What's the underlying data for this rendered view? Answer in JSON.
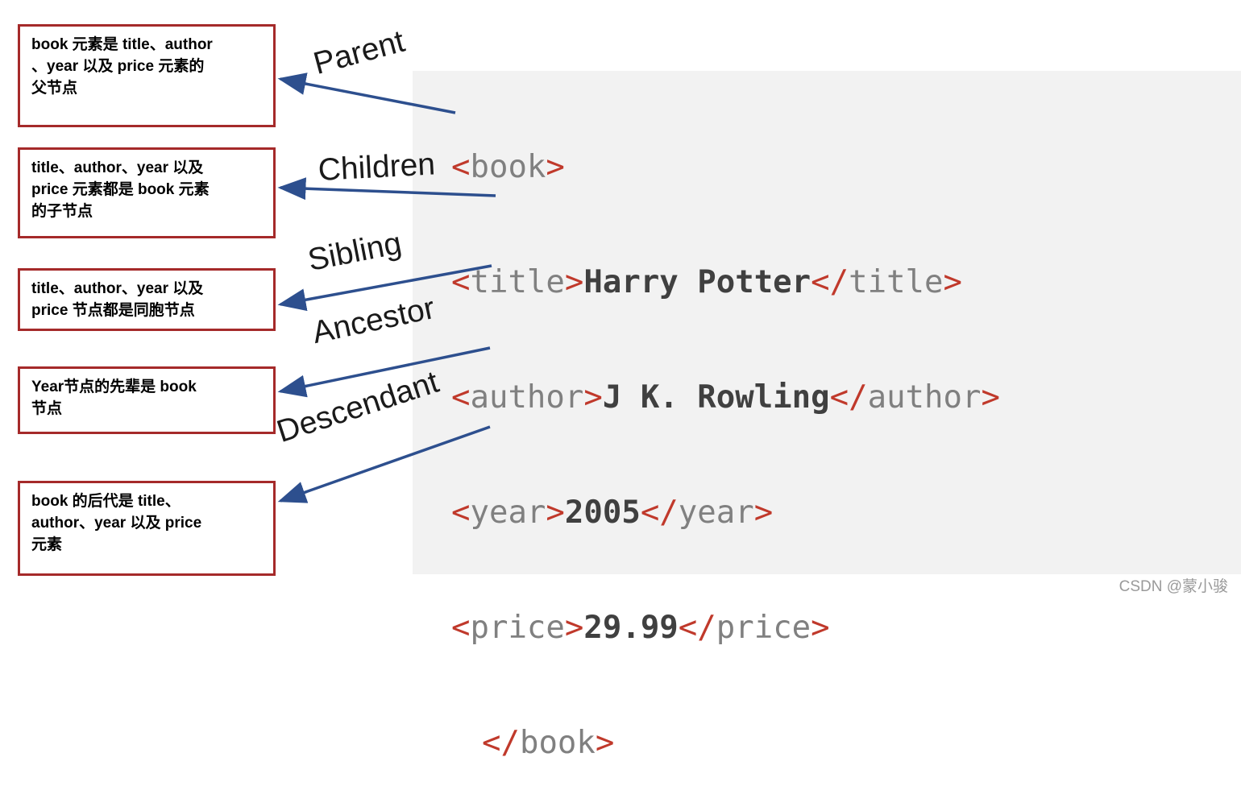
{
  "diagram": {
    "title_watermark": "CSDN @蒙小骏",
    "callouts": [
      {
        "id": "parent-callout",
        "text": "book 元素是 title、author\n、year 以及 price 元素的\n父节点"
      },
      {
        "id": "children-callout",
        "text": "title、author、year 以及\nprice 元素都是 book 元素\n的子节点"
      },
      {
        "id": "sibling-callout",
        "text": "title、author、year 以及\nprice 节点都是同胞节点"
      },
      {
        "id": "ancestor-callout",
        "text": "Year节点的先辈是 book\n节点"
      },
      {
        "id": "descendant-callout",
        "text": "book 的后代是 title、\nauthor、year 以及 price\n元素"
      }
    ],
    "relations": [
      {
        "id": "parent",
        "label": "Parent"
      },
      {
        "id": "children",
        "label": "Children"
      },
      {
        "id": "sibling",
        "label": "Sibling"
      },
      {
        "id": "ancestor",
        "label": "Ancestor"
      },
      {
        "id": "descendant",
        "label": "Descendant"
      }
    ],
    "code": {
      "lines": [
        {
          "indent": 0,
          "open_lt": "<",
          "open_name": "book",
          "open_gt": ">",
          "value": "",
          "close": ""
        },
        {
          "indent": 0,
          "open_lt": "<",
          "open_name": "title",
          "open_gt": ">",
          "value": "Harry Potter",
          "close": "</title>"
        },
        {
          "indent": 0,
          "open_lt": "<",
          "open_name": "author",
          "open_gt": ">",
          "value": "J K. Rowling",
          "close": "</author>"
        },
        {
          "indent": 0,
          "open_lt": "<",
          "open_name": "year",
          "open_gt": ">",
          "value": "2005",
          "close": "</year>"
        },
        {
          "indent": 0,
          "open_lt": "<",
          "open_name": "price",
          "open_gt": ">",
          "value": "29.99",
          "close": "</price>"
        },
        {
          "indent": 1,
          "open_lt": "",
          "open_name": "",
          "open_gt": "",
          "value": "",
          "close": "</book>"
        }
      ]
    },
    "colors": {
      "callout_border": "#a52a2a",
      "arrow": "#2d4f8e",
      "tag_punct": "#c0392b",
      "tag_name": "#808080",
      "panel_bg": "#f2f2f2"
    }
  }
}
